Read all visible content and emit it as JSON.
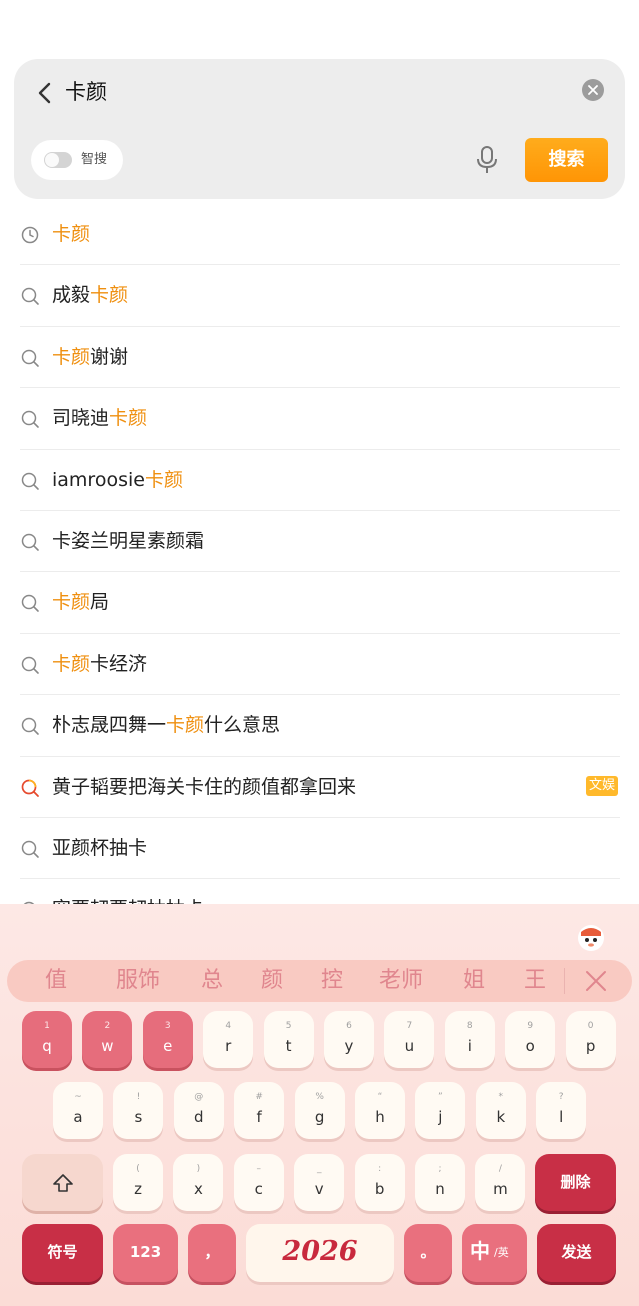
{
  "search": {
    "query": "卡颜",
    "smart_toggle_label": "智搜",
    "search_button_label": "搜索"
  },
  "suggestions": [
    {
      "type": "history",
      "parts": [
        {
          "t": "卡颜",
          "hl": true
        }
      ]
    },
    {
      "type": "search",
      "parts": [
        {
          "t": "成毅",
          "hl": false
        },
        {
          "t": "卡颜",
          "hl": true
        }
      ]
    },
    {
      "type": "search",
      "parts": [
        {
          "t": "卡颜",
          "hl": true
        },
        {
          "t": "谢谢",
          "hl": false
        }
      ]
    },
    {
      "type": "search",
      "parts": [
        {
          "t": "司晓迪",
          "hl": false
        },
        {
          "t": "卡颜",
          "hl": true
        }
      ]
    },
    {
      "type": "search",
      "parts": [
        {
          "t": "iamroosie",
          "hl": false
        },
        {
          "t": "卡颜",
          "hl": true
        }
      ]
    },
    {
      "type": "search",
      "parts": [
        {
          "t": "卡姿兰明星素颜霜",
          "hl": false
        }
      ]
    },
    {
      "type": "search",
      "parts": [
        {
          "t": "卡颜",
          "hl": true
        },
        {
          "t": "局",
          "hl": false
        }
      ]
    },
    {
      "type": "search",
      "parts": [
        {
          "t": "卡颜",
          "hl": true
        },
        {
          "t": "卡经济",
          "hl": false
        }
      ]
    },
    {
      "type": "search",
      "parts": [
        {
          "t": "朴志晟四舞一",
          "hl": false
        },
        {
          "t": "卡颜",
          "hl": true
        },
        {
          "t": "什么意思",
          "hl": false
        }
      ]
    },
    {
      "type": "hot",
      "parts": [
        {
          "t": "黄子韬要把海关卡住的颜值都拿回来",
          "hl": false
        }
      ],
      "tag": "文娱"
    },
    {
      "type": "search",
      "parts": [
        {
          "t": "亚颜杯抽卡",
          "hl": false
        }
      ]
    },
    {
      "type": "search",
      "parts": [
        {
          "t": "突要韧要韧抽抽卡",
          "hl": false
        }
      ]
    }
  ],
  "keyboard": {
    "candidates": [
      "值",
      "服饰",
      "总",
      "颜",
      "控",
      "老师",
      "姐",
      "王"
    ],
    "row1": [
      {
        "main": "q",
        "sub": "1",
        "pressed": true
      },
      {
        "main": "w",
        "sub": "2",
        "pressed": true
      },
      {
        "main": "e",
        "sub": "3",
        "pressed": true
      },
      {
        "main": "r",
        "sub": "4"
      },
      {
        "main": "t",
        "sub": "5"
      },
      {
        "main": "y",
        "sub": "6"
      },
      {
        "main": "u",
        "sub": "7"
      },
      {
        "main": "i",
        "sub": "8"
      },
      {
        "main": "o",
        "sub": "9"
      },
      {
        "main": "p",
        "sub": "0"
      }
    ],
    "row2": [
      {
        "main": "a",
        "sub": "~"
      },
      {
        "main": "s",
        "sub": "!"
      },
      {
        "main": "d",
        "sub": "@"
      },
      {
        "main": "f",
        "sub": "#"
      },
      {
        "main": "g",
        "sub": "%"
      },
      {
        "main": "h",
        "sub": "“"
      },
      {
        "main": "j",
        "sub": "”"
      },
      {
        "main": "k",
        "sub": "*"
      },
      {
        "main": "l",
        "sub": "?"
      }
    ],
    "row3": [
      {
        "main": "z",
        "sub": "("
      },
      {
        "main": "x",
        "sub": ")"
      },
      {
        "main": "c",
        "sub": "–"
      },
      {
        "main": "v",
        "sub": "_"
      },
      {
        "main": "b",
        "sub": ":"
      },
      {
        "main": "n",
        "sub": ";"
      },
      {
        "main": "m",
        "sub": "/"
      }
    ],
    "delete_label": "删除",
    "symbol_label": "符号",
    "number_label": "123",
    "comma_label": "，",
    "space_label": "2026",
    "period_label": "。",
    "lang_label": "中",
    "lang_sub": "/英",
    "send_label": "发送"
  },
  "colors": {
    "accent": "#ff9d0f",
    "highlight": "#ef8f0f",
    "keyboard_bg": "#fde8e5",
    "key_pressed": "#e66d7c",
    "key_dark": "#c82f46"
  }
}
